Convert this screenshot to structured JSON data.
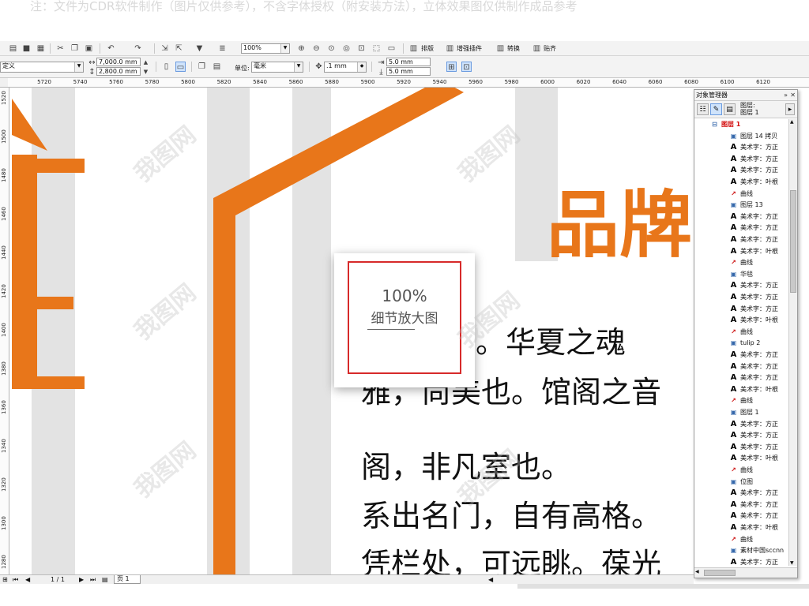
{
  "notice": "注：文件为CDR软件制作（图片仅供参考），不含字体授权（附安装方法），立体效果图仅供制作成品参考",
  "toolbar": {
    "zoom_value": "100%",
    "buttons": [
      {
        "name": "arrange",
        "label": "排版"
      },
      {
        "name": "enhance-plugin",
        "label": "增强插件"
      },
      {
        "name": "convert",
        "label": "转换"
      },
      {
        "name": "align",
        "label": "贴齐"
      }
    ]
  },
  "propertybar": {
    "preset": "定义",
    "width": "7,000.0 mm",
    "height": "2,800.0 mm",
    "unit_label": "单位:",
    "unit_value": "毫米",
    "nudge": ".1 mm",
    "dup_x": "5.0 mm",
    "dup_y": "5.0 mm"
  },
  "ruler_h": [
    "5720",
    "5740",
    "5760",
    "5780",
    "5800",
    "5820",
    "5840",
    "5860",
    "5880",
    "5900",
    "5920",
    "5940",
    "5960",
    "5980",
    "6000",
    "6020",
    "6040",
    "6060",
    "6080",
    "6100",
    "6120"
  ],
  "ruler_v": [
    "1520",
    "1500",
    "1480",
    "1460",
    "1440",
    "1420",
    "1400",
    "1380",
    "1360",
    "1340",
    "1320",
    "1300",
    "1280"
  ],
  "canvas": {
    "brand_text": "品牌",
    "lines": [
      "道也。华夏之魂",
      "雅，尚美也。馆阁之音",
      "阁，非凡室也。",
      "系出名门，自有高格。",
      "凭栏处，可远眺。葆光"
    ],
    "colors": {
      "accent": "#e8761a",
      "stripe": "#e3e3e3"
    }
  },
  "zoom_overlay": {
    "percent": "100%",
    "caption": "细节放大图"
  },
  "object_manager": {
    "title": "对象管理器",
    "layer_label_1": "图层:",
    "layer_label_2": "图层 1",
    "rows": [
      {
        "type": "layer",
        "label": "图层 1"
      },
      {
        "type": "group",
        "label": "图层 14 拷贝"
      },
      {
        "type": "text",
        "label": "美术字：方正"
      },
      {
        "type": "text",
        "label": "美术字：方正"
      },
      {
        "type": "text",
        "label": "美术字：方正"
      },
      {
        "type": "text",
        "label": "美术字：叶根"
      },
      {
        "type": "curve",
        "label": "曲线"
      },
      {
        "type": "group",
        "label": "图层 13"
      },
      {
        "type": "text",
        "label": "美术字：方正"
      },
      {
        "type": "text",
        "label": "美术字：方正"
      },
      {
        "type": "text",
        "label": "美术字：方正"
      },
      {
        "type": "text",
        "label": "美术字：叶根"
      },
      {
        "type": "curve",
        "label": "曲线"
      },
      {
        "type": "group",
        "label": "华毯"
      },
      {
        "type": "text",
        "label": "美术字：方正"
      },
      {
        "type": "text",
        "label": "美术字：方正"
      },
      {
        "type": "text",
        "label": "美术字：方正"
      },
      {
        "type": "text",
        "label": "美术字：叶根"
      },
      {
        "type": "curve",
        "label": "曲线"
      },
      {
        "type": "group",
        "label": "tulip 2"
      },
      {
        "type": "text",
        "label": "美术字：方正"
      },
      {
        "type": "text",
        "label": "美术字：方正"
      },
      {
        "type": "text",
        "label": "美术字：方正"
      },
      {
        "type": "text",
        "label": "美术字：叶根"
      },
      {
        "type": "curve",
        "label": "曲线"
      },
      {
        "type": "group",
        "label": "图层 1"
      },
      {
        "type": "text",
        "label": "美术字：方正"
      },
      {
        "type": "text",
        "label": "美术字：方正"
      },
      {
        "type": "text",
        "label": "美术字：方正"
      },
      {
        "type": "text",
        "label": "美术字：叶根"
      },
      {
        "type": "curve",
        "label": "曲线"
      },
      {
        "type": "group",
        "label": "位图"
      },
      {
        "type": "text",
        "label": "美术字：方正"
      },
      {
        "type": "text",
        "label": "美术字：方正"
      },
      {
        "type": "text",
        "label": "美术字：方正"
      },
      {
        "type": "text",
        "label": "美术字：叶根"
      },
      {
        "type": "curve",
        "label": "曲线"
      },
      {
        "type": "group",
        "label": "素材中国sccnn"
      },
      {
        "type": "text",
        "label": "美术字：方正"
      }
    ]
  },
  "status": {
    "page_counter": "1 / 1",
    "page_tab": "页 1"
  },
  "watermark": "我图网"
}
